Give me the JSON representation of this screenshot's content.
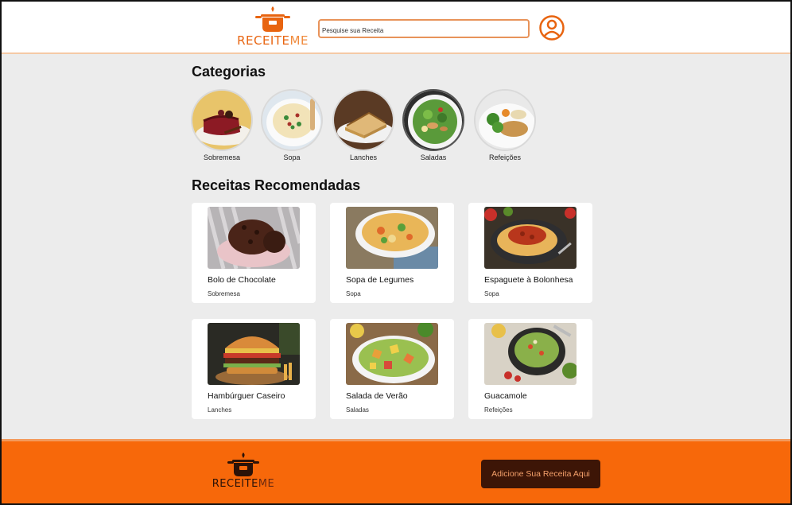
{
  "header": {
    "logo_text": "RECEITE",
    "logo_text_accent": "ME",
    "search_placeholder": "Pesquise sua Receita"
  },
  "categories": {
    "title": "Categorias",
    "items": [
      {
        "label": "Sobremesa"
      },
      {
        "label": "Sopa"
      },
      {
        "label": "Lanches"
      },
      {
        "label": "Saladas"
      },
      {
        "label": "Refeições"
      }
    ]
  },
  "recommended": {
    "title": "Receitas Recomendadas",
    "cards": [
      {
        "title": "Bolo de Chocolate",
        "category": "Sobremesa"
      },
      {
        "title": "Sopa de Legumes",
        "category": "Sopa"
      },
      {
        "title": "Espaguete à Bolonhesa",
        "category": "Sopa"
      },
      {
        "title": "Hambúrguer Caseiro",
        "category": "Lanches"
      },
      {
        "title": "Salada de Verão",
        "category": "Saladas"
      },
      {
        "title": "Guacamole",
        "category": "Refeições"
      }
    ]
  },
  "footer": {
    "logo_text": "RECEITE",
    "logo_text_accent": "ME",
    "add_button": "Adicione Sua Receita Aqui"
  },
  "colors": {
    "brand_orange": "#f7680a",
    "button_dark": "#3d1506",
    "background": "#ececec"
  }
}
